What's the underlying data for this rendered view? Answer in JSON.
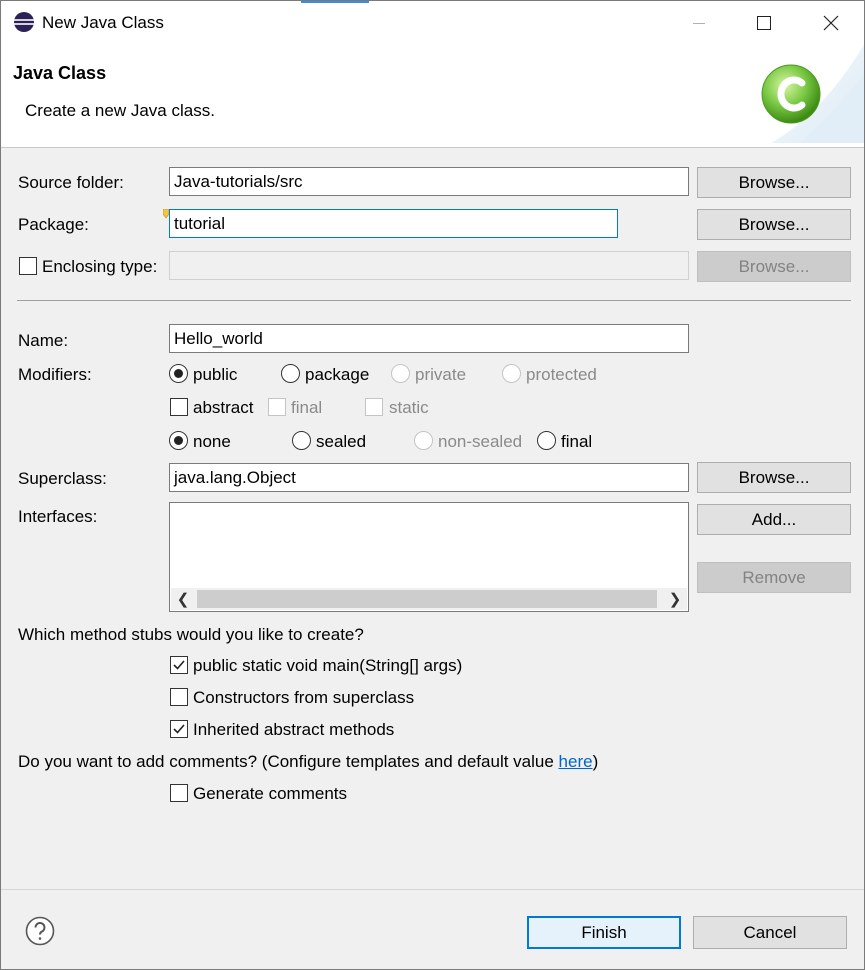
{
  "window": {
    "title": "New Java Class"
  },
  "banner": {
    "title": "Java Class",
    "description": "Create a new Java class."
  },
  "form": {
    "source_folder": {
      "label": "Source folder:",
      "value": "Java-tutorials/src",
      "browse": "Browse..."
    },
    "package": {
      "label": "Package:",
      "value": "tutorial",
      "browse": "Browse..."
    },
    "enclosing_type": {
      "label": "Enclosing type:",
      "value": "",
      "browse": "Browse..."
    },
    "name": {
      "label": "Name:",
      "value": "Hello_world"
    },
    "modifiers": {
      "label": "Modifiers:",
      "access": [
        "public",
        "package",
        "private",
        "protected"
      ],
      "flags": [
        "abstract",
        "final",
        "static"
      ],
      "inheritance": [
        "none",
        "sealed",
        "non-sealed",
        "final"
      ]
    },
    "superclass": {
      "label": "Superclass:",
      "value": "java.lang.Object",
      "browse": "Browse..."
    },
    "interfaces": {
      "label": "Interfaces:",
      "add": "Add...",
      "remove": "Remove"
    },
    "stubs": {
      "question": "Which method stubs would you like to create?",
      "main": "public static void main(String[] args)",
      "constructors": "Constructors from superclass",
      "inherited": "Inherited abstract methods"
    },
    "comments": {
      "question_prefix": "Do you want to add comments? (Configure templates and default value ",
      "link": "here",
      "question_suffix": ")",
      "generate": "Generate comments"
    }
  },
  "footer": {
    "finish": "Finish",
    "cancel": "Cancel"
  },
  "state": {
    "access_selected": "public",
    "inheritance_selected": "none",
    "stub_main_checked": true,
    "stub_constructors_checked": false,
    "stub_inherited_checked": true,
    "generate_comments_checked": false,
    "abstract_checked": false,
    "enclosing_type_checked": false
  },
  "icons": [
    "eclipse-app-icon",
    "minimize-icon",
    "maximize-icon",
    "close-icon",
    "java-class-logo-icon",
    "checkmark-icon",
    "scroll-left-icon",
    "scroll-right-icon",
    "help-icon",
    "content-assist-marker-icon"
  ],
  "colors": {
    "accent": "#0078d7",
    "link": "#0066cc",
    "logo_green": "#7ac943"
  }
}
